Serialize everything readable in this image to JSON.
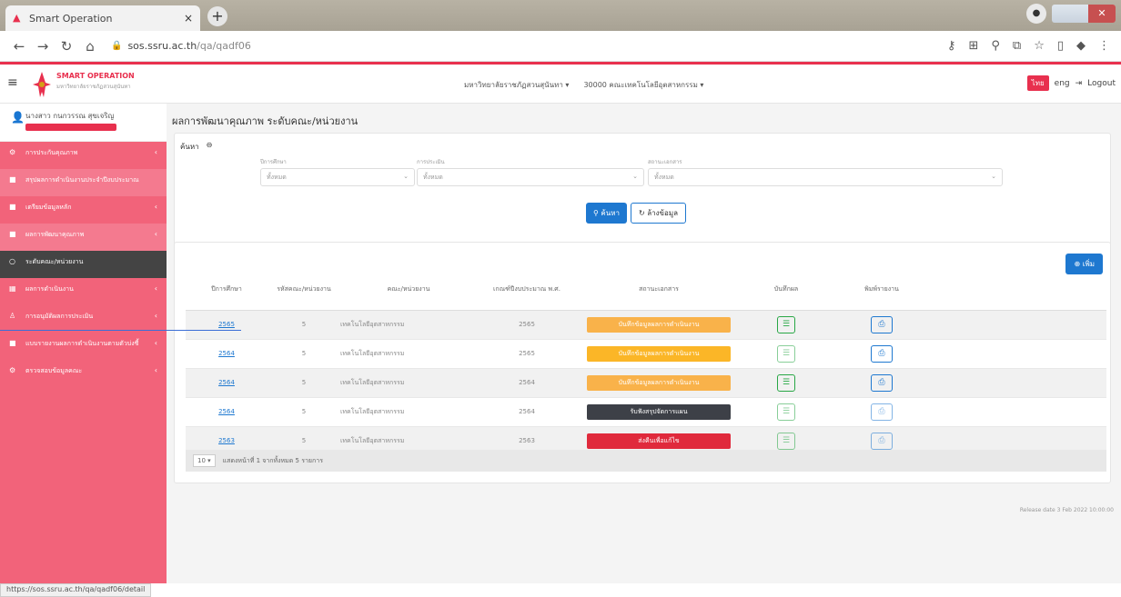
{
  "browser": {
    "tab_title": "Smart Operation",
    "tab_close": "×",
    "new_tab": "+",
    "url_host": "sos.ssru.ac.th",
    "url_path": "/qa/qadf06"
  },
  "header": {
    "brand_title": "SMART OPERATION",
    "brand_subtitle": "มหาวิทยาลัยราชภัฏสวนสุนันทา",
    "university_select": "มหาวิทยาลัยราชภัฏสวนสุนันทา ▾",
    "unit_select": "30000 คณะเทคโนโลยีอุตสาหกรรม ▾",
    "lang_th": "ไทย",
    "lang_en": "eng",
    "logout": "Logout"
  },
  "sidebar": {
    "user_name": "นางสาว กนกวรรณ สุขเจริญ",
    "items": [
      {
        "label": "การประกันคุณภาพ",
        "icon": "gear-icon",
        "arrow": "‹"
      },
      {
        "label": "สรุปผลการดำเนินงานประจำปีงบประมาณ",
        "icon": "square-icon",
        "arrow": ""
      },
      {
        "label": "เตรียมข้อมูลหลัก",
        "icon": "square-icon",
        "arrow": "‹"
      },
      {
        "label": "ผลการพัฒนาคุณภาพ",
        "icon": "square-icon",
        "arrow": "‹"
      },
      {
        "label": "ระดับคณะ/หน่วยงาน",
        "icon": "circle-icon",
        "arrow": ""
      },
      {
        "label": "ผลการดำเนินงาน",
        "icon": "chart-icon",
        "arrow": "‹"
      },
      {
        "label": "การอนุมัติผลการประเมิน",
        "icon": "user-icon",
        "arrow": "‹"
      },
      {
        "label": "แบบรายงานผลการดำเนินงานตามตัวบ่งชี้",
        "icon": "square-icon",
        "arrow": "‹"
      },
      {
        "label": "ตรวจสอบข้อมูลคณะ",
        "icon": "gear-icon",
        "arrow": "‹"
      }
    ]
  },
  "main": {
    "page_title": "ผลการพัฒนาคุณภาพ ระดับคณะ/หน่วยงาน",
    "search_label": "ค้นหา",
    "fields": [
      {
        "label": "ปีการศึกษา",
        "value": "ทั้งหมด"
      },
      {
        "label": "การประเมิน",
        "value": "ทั้งหมด"
      },
      {
        "label": "สถานะเอกสาร",
        "value": "ทั้งหมด"
      }
    ],
    "search_button": "ค้นหา",
    "clear_button": "ล้างข้อมูล",
    "add_button": "เพิ่ม",
    "columns": [
      "ปีการศึกษา",
      "รหัสคณะ/หน่วยงาน",
      "คณะ/หน่วยงาน",
      "เกณฑ์ปีงบประมาณ พ.ศ.",
      "สถานะเอกสาร",
      "บันทึกผล",
      "พิมพ์รายงาน"
    ],
    "rows": [
      {
        "year": "2565",
        "code": "5",
        "unit": "เทคโนโลยีอุตสาหกรรม",
        "budget_year": "2565",
        "status": "บันทึกข้อมูลผลการดำเนินงาน",
        "status_color": "#f9b24a"
      },
      {
        "year": "2564",
        "code": "5",
        "unit": "เทคโนโลยีอุตสาหกรรม",
        "budget_year": "2565",
        "status": "บันทึกข้อมูลผลการดำเนินงาน",
        "status_color": "#fbb627"
      },
      {
        "year": "2564",
        "code": "5",
        "unit": "เทคโนโลยีอุตสาหกรรม",
        "budget_year": "2564",
        "status": "บันทึกข้อมูลผลการดำเนินงาน",
        "status_color": "#f9b24a"
      },
      {
        "year": "2564",
        "code": "5",
        "unit": "เทคโนโลยีอุตสาหกรรม",
        "budget_year": "2564",
        "status": "รับฟังสรุปจัดการแผน",
        "status_color": "#3d4047"
      },
      {
        "year": "2563",
        "code": "5",
        "unit": "เทคโนโลยีอุตสาหกรรม",
        "budget_year": "2563",
        "status": "ส่งคืนเพื่อแก้ไข",
        "status_color": "#e02a3c"
      }
    ],
    "page_size": "10 ▾",
    "pager_text": "แสดงหน้าที่ 1 จากทั้งหมด 5 รายการ",
    "release": "Release date 3 Feb 2022 10:00:00"
  },
  "statusbar": {
    "url": "https://sos.ssru.ac.th/qa/qadf06/detail"
  }
}
